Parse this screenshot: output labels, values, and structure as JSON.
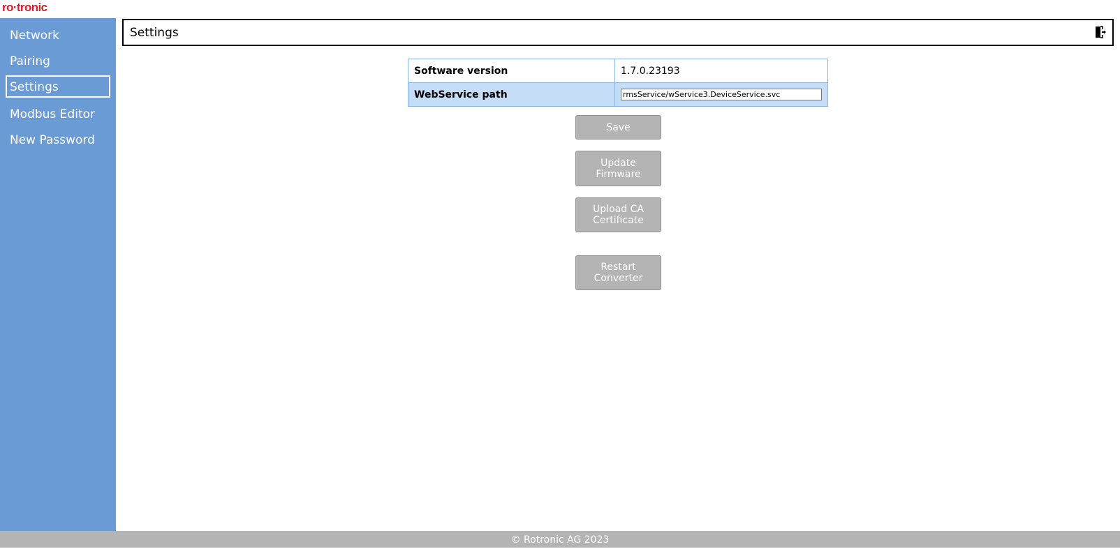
{
  "brand": {
    "logo_text": "ro·tronic",
    "logo_color": "#d4202b"
  },
  "colors": {
    "sidebar": "#6a9bd5",
    "row_highlight": "#c6ddf7",
    "button": "#b4b4b4",
    "footer": "#b4b4b4"
  },
  "sidebar": {
    "items": [
      {
        "label": "Network"
      },
      {
        "label": "Pairing"
      },
      {
        "label": "Settings",
        "active": true
      },
      {
        "label": "Modbus Editor"
      },
      {
        "label": "New Password"
      }
    ]
  },
  "header": {
    "title": "Settings",
    "logout_icon": "logout-icon"
  },
  "settings": {
    "software_version_label": "Software version",
    "software_version_value": "1.7.0.23193",
    "webservice_path_label": "WebService path",
    "webservice_path_value": "rmsService/wService3.DeviceService.svc"
  },
  "buttons": {
    "save": "Save",
    "update_firmware": "Update\nFirmware",
    "upload_ca": "Upload CA\nCertificate",
    "restart": "Restart\nConverter"
  },
  "footer": {
    "text": "© Rotronic AG 2023"
  }
}
